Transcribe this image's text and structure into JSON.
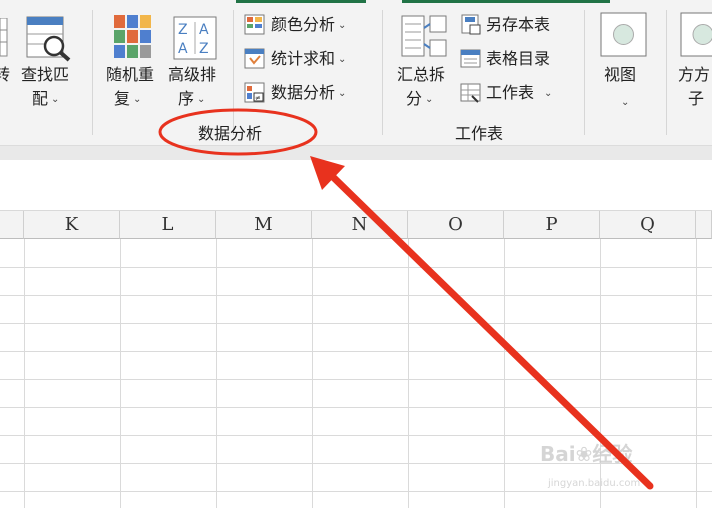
{
  "ribbon": {
    "convert_partial": "转",
    "find_match_line1": "查找匹",
    "find_match_line2": "配",
    "random_repeat_line1": "随机重",
    "random_repeat_line2": "复",
    "advanced_sort_line1": "高级排",
    "advanced_sort_line2": "序",
    "color_analysis": "颜色分析",
    "stat_sum": "统计求和",
    "data_analysis": "数据分析",
    "group_data_analysis": "数据分析",
    "summary_split_line1": "汇总拆",
    "summary_split_line2": "分",
    "save_copy": "另存本表",
    "sheet_directory": "表格目录",
    "worksheet": "工作表",
    "group_worksheet": "工作表",
    "view": "视图",
    "fangfang_line1": "方方",
    "fangfang_line2": "子"
  },
  "columns": [
    "K",
    "L",
    "M",
    "N",
    "O",
    "P",
    "Q"
  ],
  "watermark": {
    "brand": "Bai",
    "brand_suffix": "经验",
    "url": "jingyan.baidu.com"
  },
  "annotation_color": "#e8321e",
  "accent_color": "#217346"
}
